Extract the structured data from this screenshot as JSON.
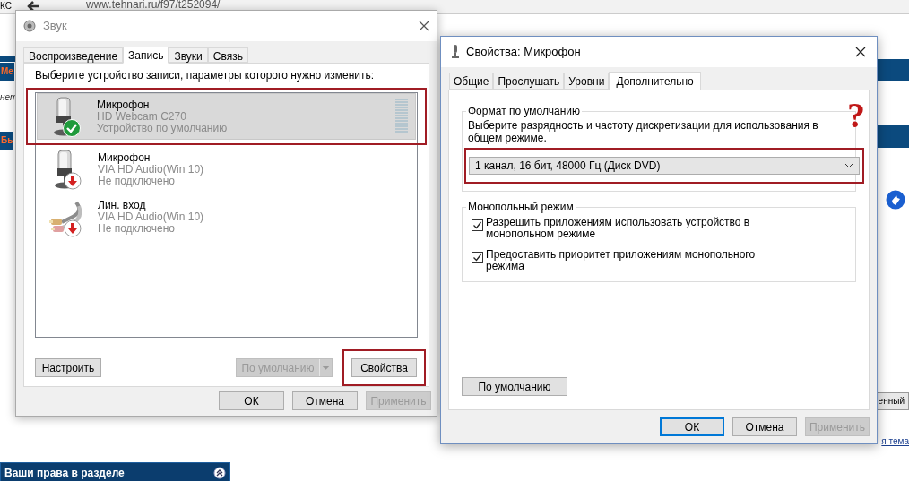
{
  "browser": {
    "address": "www.tehnari.ru/f97/t252094/",
    "left_fragments": [
      {
        "text": "КС",
        "kind": "plain"
      },
      {
        "text": "Ме",
        "kind": "bar"
      },
      {
        "text": "нет",
        "kind": "italic"
      },
      {
        "text": "Бь",
        "kind": "bar"
      }
    ],
    "right_fragments": [
      {
        "text": "енный",
        "kind": "button"
      },
      {
        "text": "я тема",
        "kind": "link"
      }
    ],
    "panel_title": "Ваши права в разделе"
  },
  "sound_dialog": {
    "title": "Звук",
    "tabs": [
      {
        "label": "Воспроизведение",
        "selected": false
      },
      {
        "label": "Запись",
        "selected": true
      },
      {
        "label": "Звуки",
        "selected": false
      },
      {
        "label": "Связь",
        "selected": false
      }
    ],
    "instruction": "Выберите устройство записи, параметры которого нужно изменить:",
    "devices": [
      {
        "name": "Микрофон",
        "driver": "HD Webcam C270",
        "status": "Устройство по умолчанию",
        "kind": "microphone",
        "connected": true,
        "selected": true,
        "highlighted": true
      },
      {
        "name": "Микрофон",
        "driver": "VIA HD Audio(Win 10)",
        "status": "Не подключено",
        "kind": "microphone",
        "connected": false,
        "selected": false,
        "highlighted": false
      },
      {
        "name": "Лин. вход",
        "driver": "VIA HD Audio(Win 10)",
        "status": "Не подключено",
        "kind": "line-in",
        "connected": false,
        "selected": false,
        "highlighted": false
      }
    ],
    "configure_button": {
      "label": "Настроить",
      "disabled": false
    },
    "default_button": {
      "label": "По умолчанию",
      "disabled": true
    },
    "properties_button": {
      "label": "Свойства",
      "disabled": false,
      "highlighted": true
    },
    "footer_buttons": [
      {
        "label": "ОК",
        "disabled": false
      },
      {
        "label": "Отмена",
        "disabled": false
      },
      {
        "label": "Применить",
        "disabled": true
      }
    ]
  },
  "props_dialog": {
    "title": "Свойства: Микрофон",
    "tabs": [
      {
        "label": "Общие",
        "selected": false
      },
      {
        "label": "Прослушать",
        "selected": false
      },
      {
        "label": "Уровни",
        "selected": false
      },
      {
        "label": "Дополнительно",
        "selected": true
      }
    ],
    "default_format": {
      "legend": "Формат по умолчанию",
      "description": "Выберите разрядность и частоту дискретизации для использования в общем режиме.",
      "value": "1 канал, 16 бит, 48000 Гц (Диск DVD)",
      "highlighted": true,
      "mark": "?"
    },
    "exclusive": {
      "legend": "Монопольный режим",
      "options": [
        {
          "label": "Разрешить приложениям использовать устройство в монопольном режиме",
          "checked": true
        },
        {
          "label": "Предоставить приоритет приложениям монопольного режима",
          "checked": true
        }
      ]
    },
    "restore_button": {
      "label": "По умолчанию",
      "disabled": false
    },
    "footer_buttons": [
      {
        "label": "ОК",
        "disabled": false,
        "focused": true
      },
      {
        "label": "Отмена",
        "disabled": false,
        "focused": false
      },
      {
        "label": "Применить",
        "disabled": true,
        "focused": false
      }
    ]
  }
}
